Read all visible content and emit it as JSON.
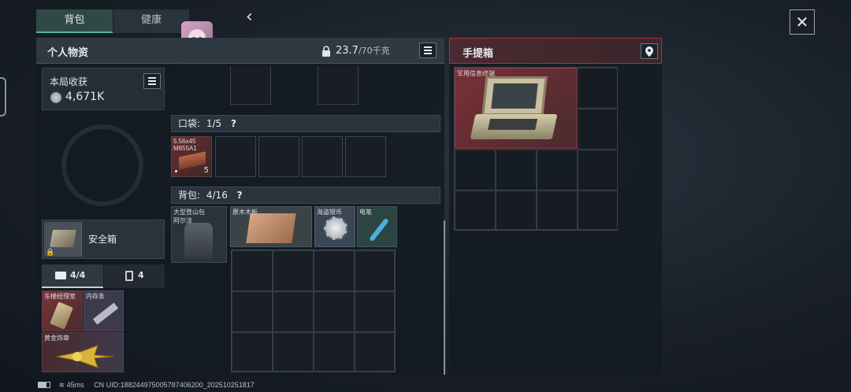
{
  "tabs": [
    {
      "label": "背包",
      "active": true
    },
    {
      "label": "健康",
      "active": false
    }
  ],
  "back_glyph": "‹",
  "close_glyph": "✕",
  "personal": {
    "title": "个人物资",
    "weight_value": "23.7",
    "weight_limit": "/70千克"
  },
  "haul": {
    "title": "本局收获",
    "value": "4,671K"
  },
  "safe_box": {
    "label": "安全箱"
  },
  "sub_tabs": [
    {
      "label": "4/4",
      "icon": "briefcase-icon",
      "active": true
    },
    {
      "label": "4",
      "icon": "clipboard-icon",
      "active": false
    }
  ],
  "safe_items": [
    {
      "label": "东楼经理室",
      "icon": "keycard-icon"
    },
    {
      "label": "内存条",
      "icon": "memory-stick-icon"
    },
    {
      "label": "黄金饰章",
      "icon": "gold-emblem-icon"
    }
  ],
  "pocket": {
    "title": "口袋:",
    "count": "1/5",
    "help": "?",
    "items": [
      {
        "label": "5.56x45",
        "label2": "M855A1",
        "count": "5",
        "icon": "ammo-box-icon"
      }
    ]
  },
  "backpack": {
    "title": "背包:",
    "count": "4/16",
    "help": "?",
    "bag": {
      "label": "大型登山包",
      "label2": "阿尔法",
      "icon": "backpack-icon"
    },
    "items": [
      {
        "label": "原木木板",
        "icon": "wood-plank-icon"
      },
      {
        "label": "海盗银币",
        "icon": "silver-coin-icon"
      },
      {
        "label": "电笔",
        "icon": "test-pen-icon"
      }
    ]
  },
  "case": {
    "title": "手提箱",
    "item": {
      "label": "军用信息终端",
      "icon": "military-terminal-icon"
    }
  },
  "footer": {
    "ping": "45ms",
    "uid": "CN UID:18824497500578740620​0_20251025181​7"
  },
  "colors": {
    "accent_red": "#a8323c",
    "tab_active": "#2f5a4f"
  }
}
